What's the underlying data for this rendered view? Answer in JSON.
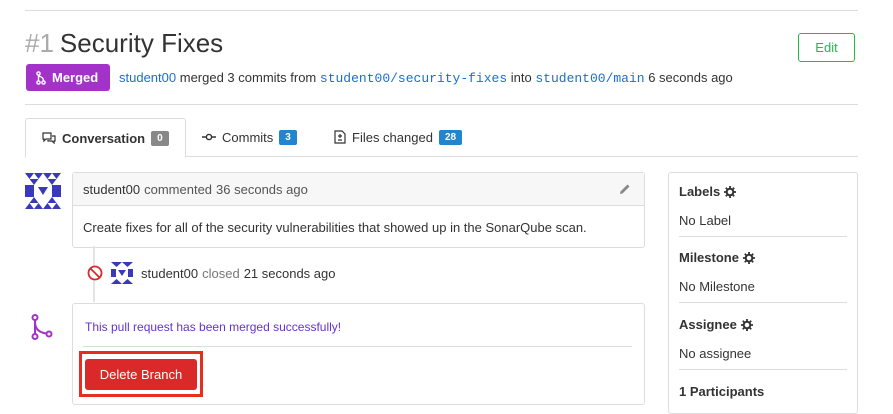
{
  "pr": {
    "number": "#1",
    "title": "Security Fixes",
    "edit_label": "Edit",
    "status_badge": "Merged",
    "merge_user": "student00",
    "merge_text_1": "merged 3 commits from",
    "source_branch": "student00/security-fixes",
    "merge_text_2": "into",
    "target_branch": "student00/main",
    "merge_time": "6 seconds ago"
  },
  "tabs": [
    {
      "label": "Conversation",
      "count": "0",
      "icon": "comment-icon"
    },
    {
      "label": "Commits",
      "count": "3",
      "icon": "commit-icon"
    },
    {
      "label": "Files changed",
      "count": "28",
      "icon": "file-diff-icon"
    }
  ],
  "comment": {
    "author": "student00",
    "action": "commented",
    "time": "36 seconds ago",
    "body": "Create fixes for all of the security vulnerabilities that showed up in the SonarQube scan."
  },
  "event": {
    "user": "student00",
    "action": "closed",
    "time": "21 seconds ago"
  },
  "merge_box": {
    "message": "This pull request has been merged successfully!",
    "delete_label": "Delete Branch"
  },
  "sidebar": {
    "labels_title": "Labels",
    "labels_value": "No Label",
    "milestone_title": "Milestone",
    "milestone_value": "No Milestone",
    "assignee_title": "Assignee",
    "assignee_value": "No assignee",
    "participants_title": "1 Participants"
  },
  "colors": {
    "merged": "#a333c8",
    "link": "#1a6fc9",
    "delete": "#db2828",
    "highlight": "#e52e1d",
    "edit": "#21ba45"
  }
}
